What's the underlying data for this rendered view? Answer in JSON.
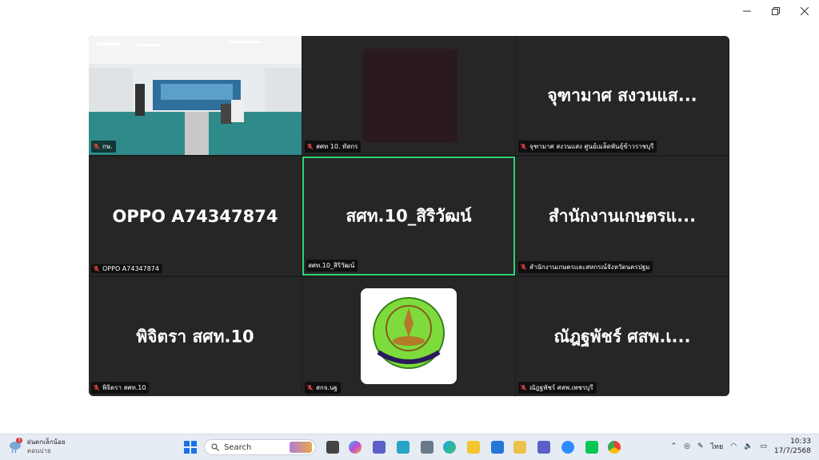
{
  "tiles": [
    {
      "label": "กษ."
    },
    {
      "label": "สศท 10. ทัสกร"
    },
    {
      "name": "จุฑามาศ สงวนแส...",
      "label": "จุฑามาศ สงวนแสง ศูนย์เมล็ดพันธุ์ข้าวราชบุรี"
    },
    {
      "name": "OPPO A74347874",
      "label": "OPPO A74347874"
    },
    {
      "name": "สศท.10_สิริวัฒน์",
      "label": "สศท.10_สิริวัฒน์"
    },
    {
      "name": "สำนักงานเกษตรแ...",
      "label": "สำนักงานเกษตรและสหกรณ์จังหวัดนครปฐม"
    },
    {
      "name": "พิจิตรา สศท.10",
      "label": "พิจิตรา สศท.10"
    },
    {
      "label": "สกจ.นฐ"
    },
    {
      "name": "ณัฎฐพัชร์ ศสพ.เ...",
      "label": "ณัฎฐพัชร์ ศสพ.เพชรบุรี"
    }
  ],
  "taskbar": {
    "weather_line1": "ฝนตกเล็กน้อย",
    "weather_line2": "ตอนบ่าย",
    "weather_badge": "3",
    "search_placeholder": "Search",
    "lang": "ไทย",
    "time": "10:33",
    "date": "17/7/2568"
  },
  "colors": {
    "active_border": "#2ed47a",
    "tile_bg": "#262626",
    "mic_muted": "#e0443e"
  }
}
